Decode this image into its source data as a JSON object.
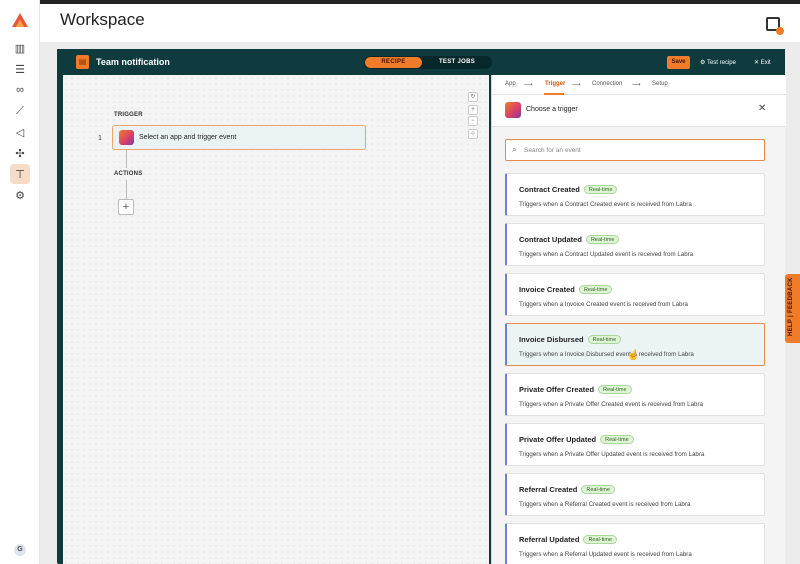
{
  "header": {
    "title": "Workspace"
  },
  "rail": {
    "items": [
      "dashboard-icon",
      "database-icon",
      "handshake-icon",
      "analytics-icon",
      "megaphone-icon",
      "puzzle-icon",
      "workflow-icon",
      "settings-icon"
    ],
    "avatar": "G"
  },
  "recipe": {
    "name": "Team notification",
    "tabs": [
      "RECIPE",
      "TEST JOBS"
    ],
    "save": "Save",
    "test": "Test recipe",
    "exit": "Exit"
  },
  "canvas": {
    "trigger_label": "TRIGGER",
    "step_number": "1",
    "trigger_text": "Select an app and trigger event",
    "actions_label": "ACTIONS",
    "add": "+"
  },
  "panel": {
    "crumbs": [
      "App",
      "Trigger",
      "Connection",
      "Setup"
    ],
    "title": "Choose a trigger",
    "search_placeholder": "Search for an event",
    "badge": "Real-time",
    "events": [
      {
        "name": "Contract Created",
        "desc": "Triggers when a Contract Created event is received from Labra"
      },
      {
        "name": "Contract Updated",
        "desc": "Triggers when a Contract Updated event is received from Labra"
      },
      {
        "name": "Invoice Created",
        "desc": "Triggers when a Invoice Created event is received from Labra"
      },
      {
        "name": "Invoice Disbursed",
        "desc": "Triggers when a Invoice Disbursed event is received from Labra"
      },
      {
        "name": "Private Offer Created",
        "desc": "Triggers when a Private Offer Created event is received from Labra"
      },
      {
        "name": "Private Offer Updated",
        "desc": "Triggers when a Private Offer Updated event is received from Labra"
      },
      {
        "name": "Referral Created",
        "desc": "Triggers when a Referral Created event is received from Labra"
      },
      {
        "name": "Referral Updated",
        "desc": "Triggers when a Referral Updated event is received from Labra"
      }
    ]
  },
  "feedback": "HELP | FEEDBACK",
  "colors": {
    "accent": "#f07c2a",
    "frame": "#0f3a3e",
    "badge_bg": "#dff3d6",
    "event_border": "#6c7fd6"
  }
}
